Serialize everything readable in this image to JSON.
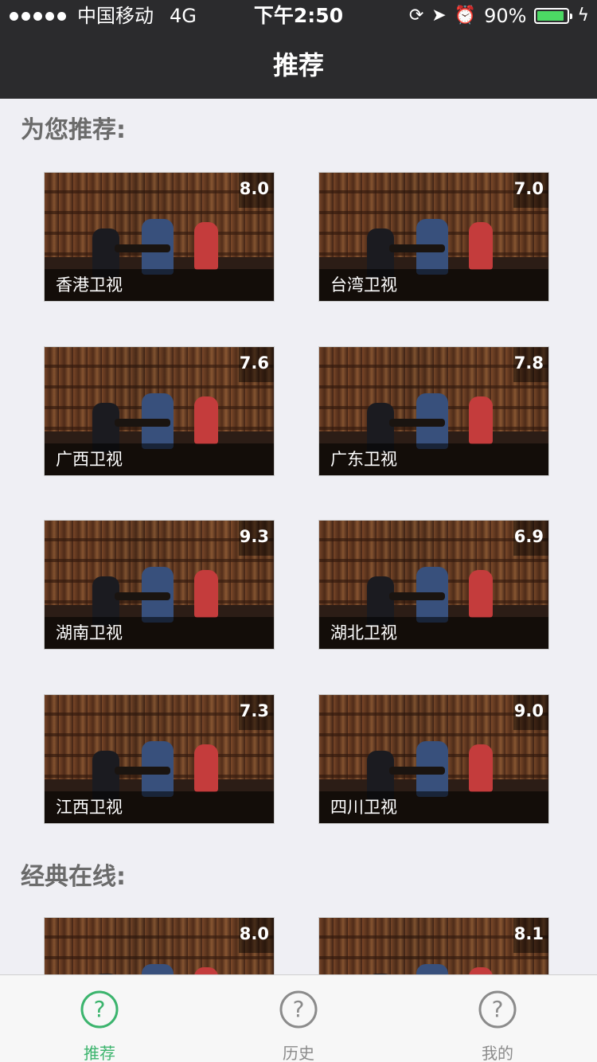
{
  "status": {
    "carrier": "中国移动",
    "network": "4G",
    "time": "下午2:50",
    "battery_text": "90%",
    "battery_level": 0.9
  },
  "nav": {
    "title": "推荐"
  },
  "sections": [
    {
      "title": "为您推荐:",
      "items": [
        {
          "label": "香港卫视",
          "score": "8.0"
        },
        {
          "label": "台湾卫视",
          "score": "7.0"
        },
        {
          "label": "广西卫视",
          "score": "7.6"
        },
        {
          "label": "广东卫视",
          "score": "7.8"
        },
        {
          "label": "湖南卫视",
          "score": "9.3"
        },
        {
          "label": "湖北卫视",
          "score": "6.9"
        },
        {
          "label": "江西卫视",
          "score": "7.3"
        },
        {
          "label": "四川卫视",
          "score": "9.0"
        }
      ]
    },
    {
      "title": "经典在线:",
      "items": [
        {
          "label": "",
          "score": "8.0"
        },
        {
          "label": "",
          "score": "8.1"
        }
      ]
    }
  ],
  "tabbar": {
    "tabs": [
      {
        "label": "推荐",
        "icon": "help-circle-icon",
        "active": true
      },
      {
        "label": "历史",
        "icon": "help-circle-icon",
        "active": false
      },
      {
        "label": "我的",
        "icon": "help-circle-icon",
        "active": false
      }
    ],
    "active_color": "#3bb46d",
    "inactive_color": "#8b8b8b"
  }
}
